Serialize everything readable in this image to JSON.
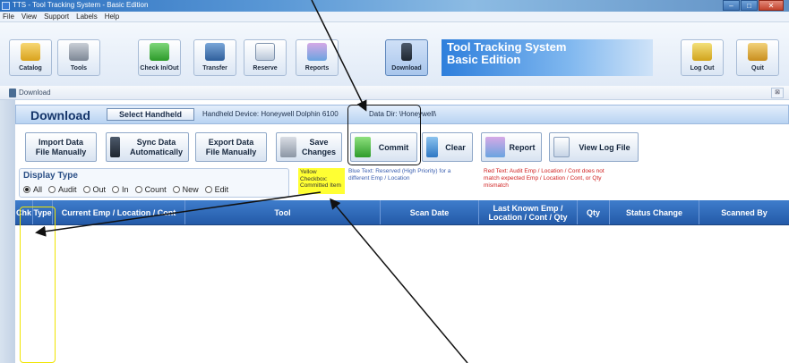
{
  "window": {
    "title": "TTS - Tool Tracking System - Basic Edition",
    "minimize": "–",
    "maximize": "□",
    "close": "✕"
  },
  "menu": [
    "File",
    "View",
    "Support",
    "Labels",
    "Help"
  ],
  "toolbar": {
    "catalog": "Catalog",
    "tools": "Tools",
    "check_in_out": "Check In/Out",
    "transfer": "Transfer",
    "reserve": "Reserve",
    "reports": "Reports",
    "download": "Download",
    "log_out": "Log Out",
    "quit": "Quit"
  },
  "banner": {
    "line1": "Tool Tracking System",
    "line2": "Basic Edition"
  },
  "doc_tab": {
    "label": "Download",
    "close": "⊠"
  },
  "download_bar": {
    "title": "Download",
    "select_handheld": "Select Handheld",
    "device": "Handheld Device:  Honeywell Dolphin 6100",
    "data_dir": "Data Dir:  \\Honeywell\\"
  },
  "actions": {
    "import_1": "Import Data",
    "import_2": "File Manually",
    "sync_1": "Sync Data",
    "sync_2": "Automatically",
    "export_1": "Export Data",
    "export_2": "File Manually",
    "save_1": "Save",
    "save_2": "Changes",
    "commit": "Commit",
    "clear": "Clear",
    "report": "Report",
    "view_log": "View Log File"
  },
  "display_type": {
    "label": "Display Type",
    "options": [
      "All",
      "Audit",
      "Out",
      "In",
      "Count",
      "New",
      "Edit"
    ],
    "selected": "All"
  },
  "legends": {
    "yellow": "Yellow Checkbox: Committed Item",
    "blue": "Blue Text:  Reserved (High Priority) for a different Emp / Location",
    "red": "Red Text:  Audit Emp / Location / Cont does not match expected Emp / Location / Cont, or Qty mismatch"
  },
  "grid_columns": [
    "Chk",
    "Type",
    "Current Emp / Location / Cont",
    "Tool",
    "Scan Date",
    "Last Known Emp / Location / Cont / Qty",
    "Qty",
    "Status Change",
    "Scanned By"
  ],
  "colors": {
    "header_blue": "#2e66b5",
    "legend_yellow": "#ffff33",
    "legend_blue_text": "#3a5fb0",
    "legend_red_text": "#d02020",
    "annotation_yellow": "#f0e400"
  }
}
